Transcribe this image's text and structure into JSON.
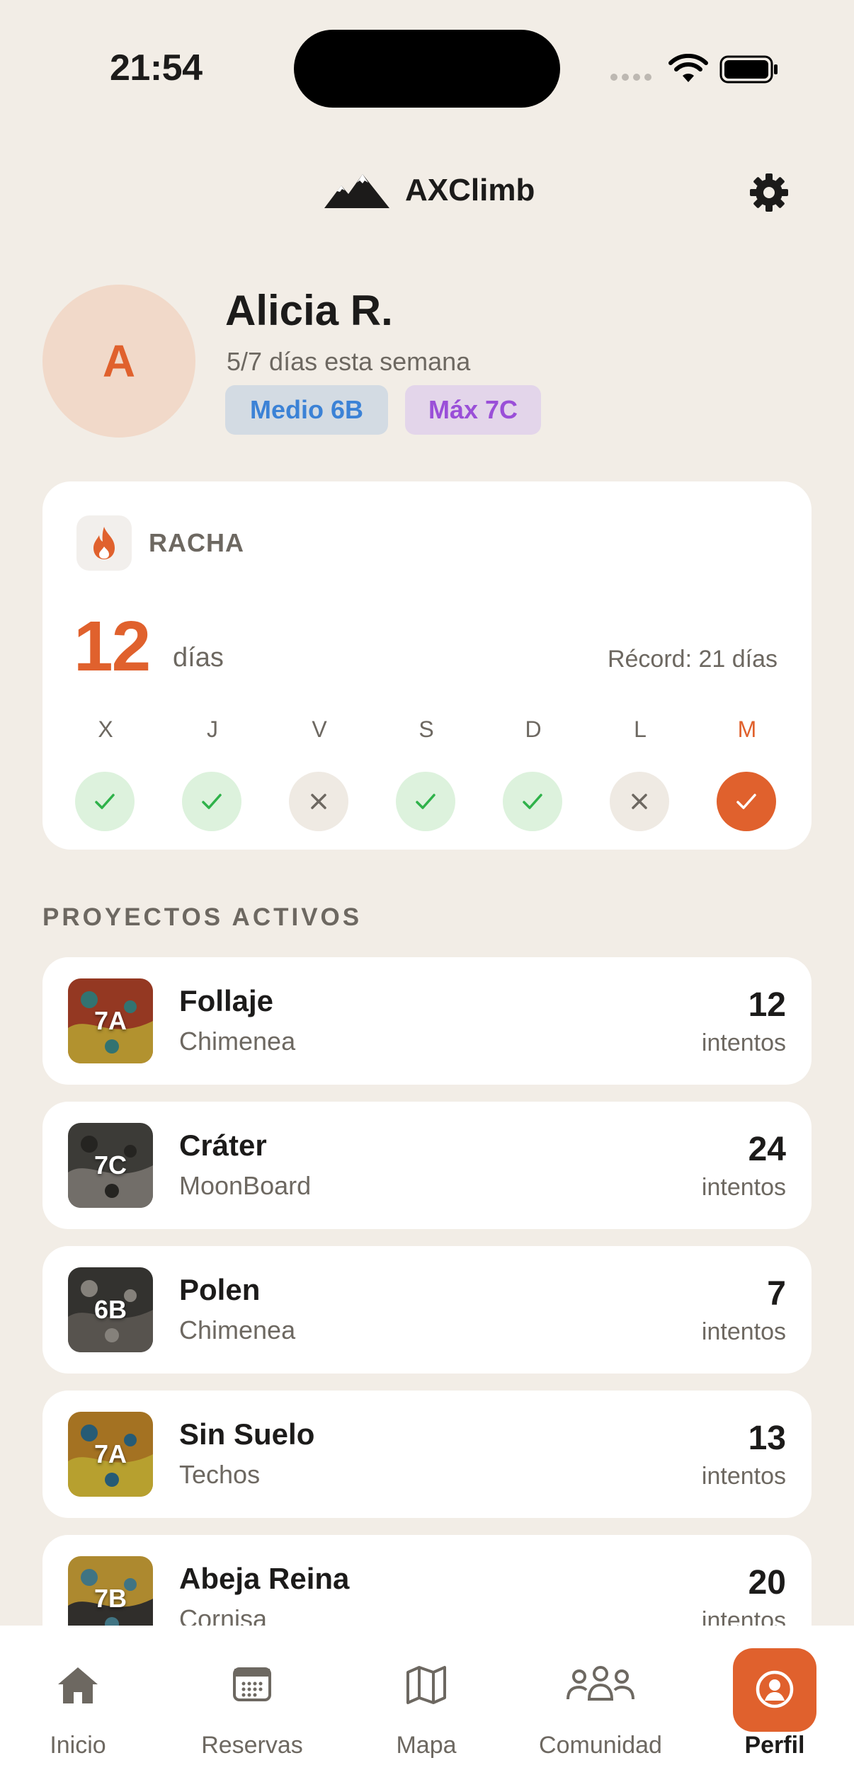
{
  "status_bar": {
    "time": "21:54"
  },
  "header": {
    "app_name": "AXClimb",
    "logo_icon": "mountain-icon",
    "settings_icon": "gear-icon"
  },
  "profile": {
    "initial": "A",
    "name": "Alicia R.",
    "subtitle": "5/7 días esta semana",
    "badge_medio": "Medio 6B",
    "badge_max": "Máx 7C"
  },
  "streak": {
    "label": "RACHA",
    "count": "12",
    "unit": "días",
    "record": "Récord: 21 días",
    "days": [
      {
        "letter": "X",
        "status": "done"
      },
      {
        "letter": "J",
        "status": "done"
      },
      {
        "letter": "V",
        "status": "missed"
      },
      {
        "letter": "S",
        "status": "done"
      },
      {
        "letter": "D",
        "status": "done"
      },
      {
        "letter": "L",
        "status": "missed"
      },
      {
        "letter": "M",
        "status": "today"
      }
    ]
  },
  "projects_section": {
    "title": "PROYECTOS ACTIVOS"
  },
  "projects": [
    {
      "grade": "7A",
      "name": "Follaje",
      "wall": "Chimenea",
      "attempts": "12",
      "attempts_label": "intentos",
      "colors": [
        "#b5452a",
        "#d9b23a",
        "#3d8d8a"
      ]
    },
    {
      "grade": "7C",
      "name": "Cráter",
      "wall": "MoonBoard",
      "attempts": "24",
      "attempts_label": "intentos",
      "colors": [
        "#4a4844",
        "#8b8780",
        "#2e2c29"
      ]
    },
    {
      "grade": "6B",
      "name": "Polen",
      "wall": "Chimenea",
      "attempts": "7",
      "attempts_label": "intentos",
      "colors": [
        "#3f3d3a",
        "#6b6660",
        "#a39e97"
      ]
    },
    {
      "grade": "7A",
      "name": "Sin Suelo",
      "wall": "Techos",
      "attempts": "13",
      "attempts_label": "intentos",
      "colors": [
        "#c98b2a",
        "#e0c43a",
        "#2f6f8f"
      ]
    },
    {
      "grade": "7B",
      "name": "Abeja Reina",
      "wall": "Cornisa",
      "attempts": "20",
      "attempts_label": "intentos",
      "colors": [
        "#d4a83a",
        "#3b3935",
        "#4f8ea0"
      ]
    }
  ],
  "tabbar": {
    "tabs": [
      {
        "label": "Inicio",
        "icon": "home-icon"
      },
      {
        "label": "Reservas",
        "icon": "calendar-icon"
      },
      {
        "label": "Mapa",
        "icon": "map-icon"
      },
      {
        "label": "Comunidad",
        "icon": "community-icon"
      },
      {
        "label": "Perfil",
        "icon": "profile-icon"
      }
    ],
    "active": "Perfil"
  }
}
